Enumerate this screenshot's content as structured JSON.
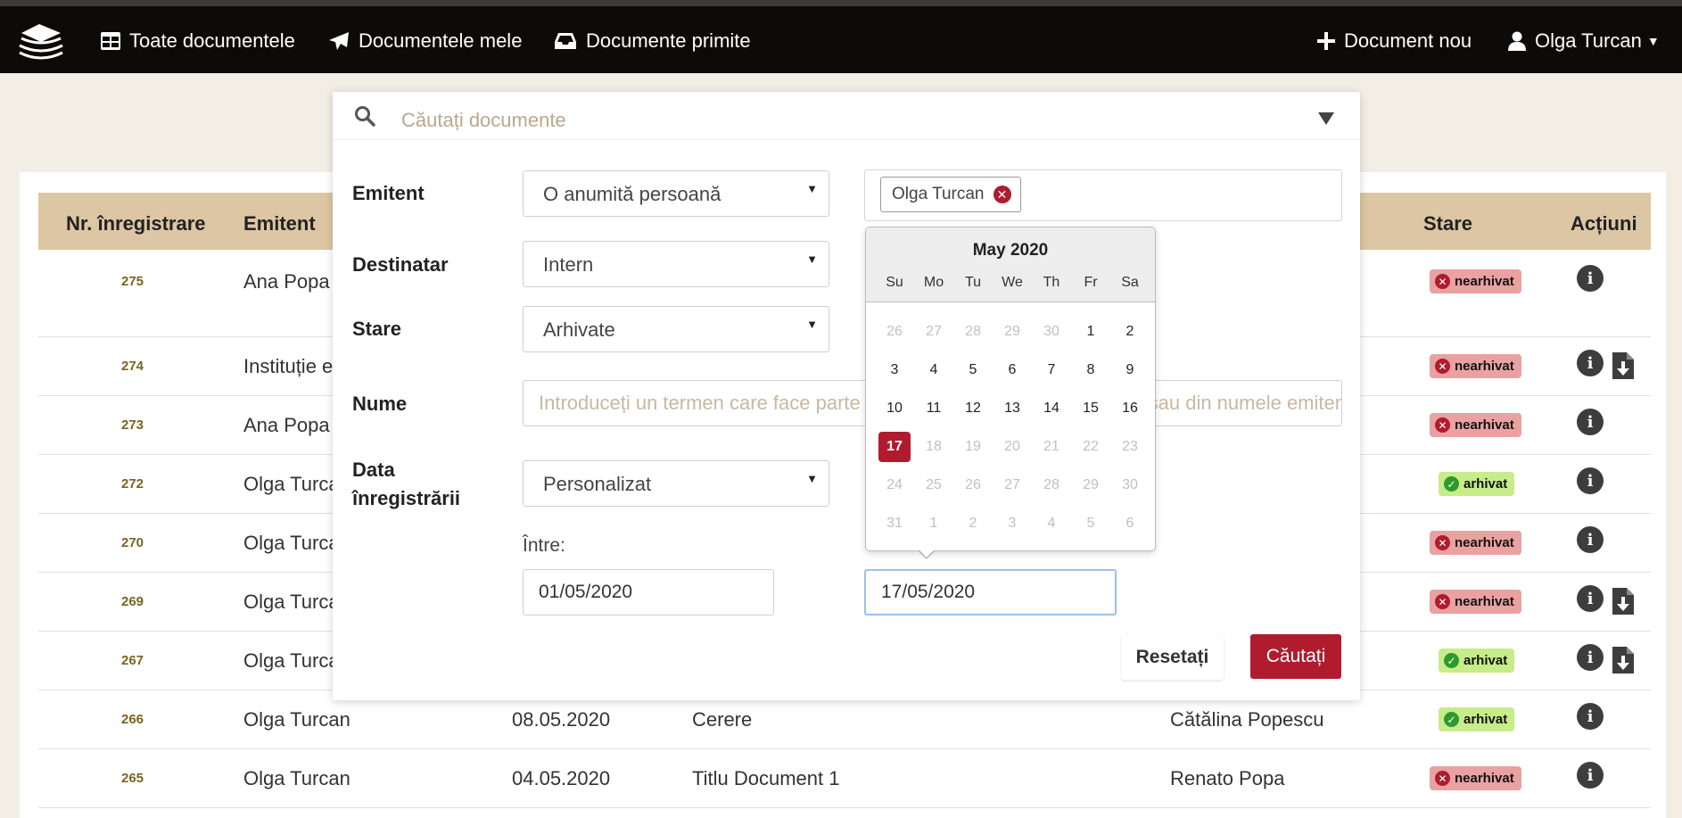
{
  "nav": {
    "items": [
      "Toate documentele",
      "Documentele mele",
      "Documente primite"
    ],
    "new_document": "Document nou",
    "user": "Olga Turcan"
  },
  "table": {
    "headers": {
      "nr": "Nr. înregistrare",
      "emitent": "Emitent",
      "stare": "Stare",
      "actiuni": "Acțiuni"
    },
    "rows": [
      {
        "nr": "275",
        "emitent": "Ana Popa",
        "data": "",
        "nume": "",
        "destinatar": "",
        "stare": "nearhivat"
      },
      {
        "nr": "274",
        "emitent": "Instituție e",
        "data": "",
        "nume": "",
        "destinatar": "",
        "stare": "nearhivat"
      },
      {
        "nr": "273",
        "emitent": "Ana Popa",
        "data": "",
        "nume": "",
        "destinatar": "",
        "stare": "nearhivat"
      },
      {
        "nr": "272",
        "emitent": "Olga Turca",
        "data": "",
        "nume": "",
        "destinatar": "",
        "stare": "arhivat"
      },
      {
        "nr": "270",
        "emitent": "Olga Turca",
        "data": "",
        "nume": "",
        "destinatar": "",
        "stare": "nearhivat"
      },
      {
        "nr": "269",
        "emitent": "Olga Turca",
        "data": "",
        "nume": "",
        "destinatar": "",
        "stare": "nearhivat"
      },
      {
        "nr": "267",
        "emitent": "Olga Turca",
        "data": "",
        "nume": "",
        "destinatar": "",
        "stare": "arhivat"
      },
      {
        "nr": "266",
        "emitent": "Olga Turcan",
        "data": "08.05.2020",
        "nume": "Cerere",
        "destinatar": "Cătălina Popescu",
        "stare": "arhivat"
      },
      {
        "nr": "265",
        "emitent": "Olga Turcan",
        "data": "04.05.2020",
        "nume": "Titlu Document 1",
        "destinatar": "Renato Popa",
        "stare": "nearhivat"
      }
    ]
  },
  "search": {
    "placeholder": "Căutați documente",
    "labels": {
      "emitent": "Emitent",
      "destinatar": "Destinatar",
      "stare": "Stare",
      "nume": "Nume",
      "data_line1": "Data",
      "data_line2": "înregistrării",
      "intre": "Între:"
    },
    "emitent_select": "O anumită persoană",
    "emitent_tag": "Olga Turcan",
    "destinatar_select": "Intern",
    "stare_select": "Arhivate",
    "nume_placeholder": "Introduceți un termen care face parte din numele documentului căutat sau din numele emitentului sau destinatarului. e",
    "data_select": "Personalizat",
    "date_from": "01/05/2020",
    "date_to": "17/05/2020",
    "reset_label": "Resetați",
    "search_label": "Căutați"
  },
  "datepicker": {
    "title": "May 2020",
    "weekdays": [
      "Su",
      "Mo",
      "Tu",
      "We",
      "Th",
      "Fr",
      "Sa"
    ],
    "weeks": [
      [
        "26",
        "27",
        "28",
        "29",
        "30",
        "1",
        "2"
      ],
      [
        "3",
        "4",
        "5",
        "6",
        "7",
        "8",
        "9"
      ],
      [
        "10",
        "11",
        "12",
        "13",
        "14",
        "15",
        "16"
      ],
      [
        "17",
        "18",
        "19",
        "20",
        "21",
        "22",
        "23"
      ],
      [
        "24",
        "25",
        "26",
        "27",
        "28",
        "29",
        "30"
      ],
      [
        "31",
        "1",
        "2",
        "3",
        "4",
        "5",
        "6"
      ]
    ],
    "selected": "17"
  },
  "colors": {
    "navbar": "#0d0a08",
    "header_row": "#dcc6a3",
    "accent_red": "#b01b2e",
    "archived_green": "#c7ec8a",
    "unarchived_red": "#eaa1a1"
  }
}
